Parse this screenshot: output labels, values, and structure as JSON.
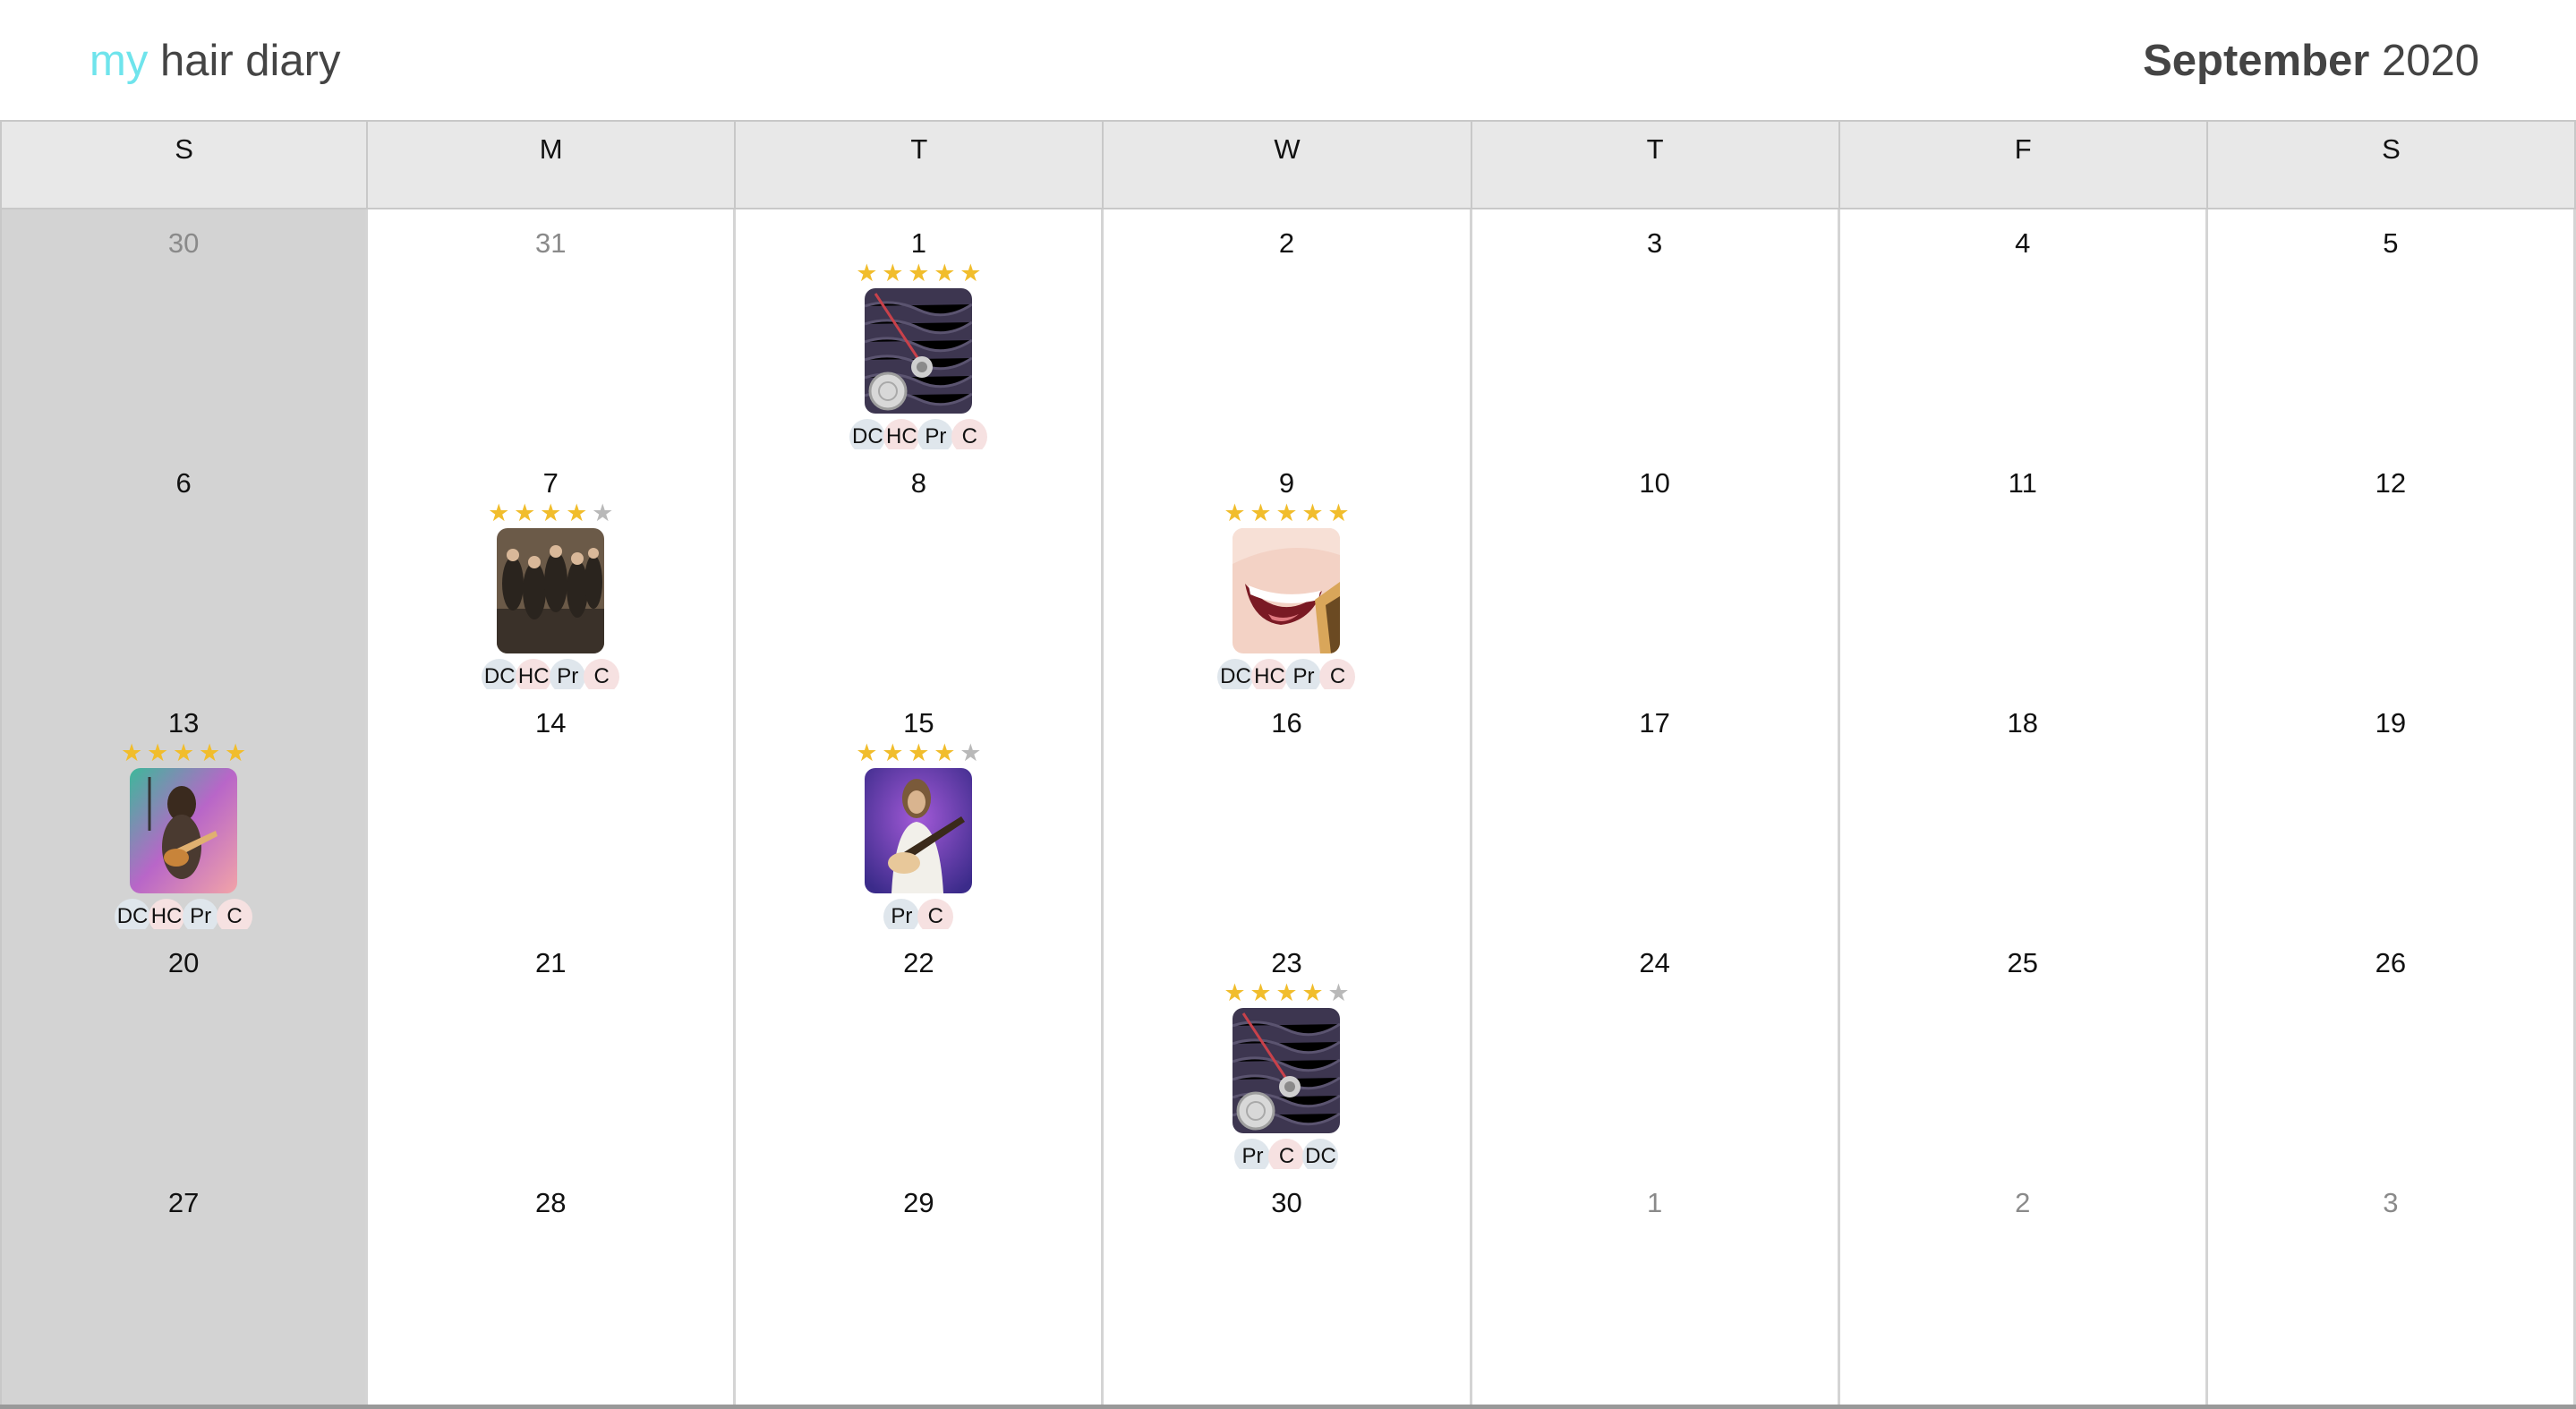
{
  "app": {
    "brand_prefix": "my",
    "brand_rest": " hair diary"
  },
  "header": {
    "month": "September",
    "year": " 2020"
  },
  "colors": {
    "brand_accent": "#6fe4ec",
    "star_on": "#f1bd2c",
    "star_off": "#b9b9b9",
    "sunday_bg": "#d3d3d3"
  },
  "weekdays": [
    "S",
    "M",
    "T",
    "W",
    "T",
    "F",
    "S"
  ],
  "weeks": [
    [
      {
        "day": "30",
        "other_month": true
      },
      {
        "day": "31",
        "other_month": true
      },
      {
        "day": "1",
        "entry": {
          "rating": 5,
          "image": "album-art-pendulum",
          "tags": [
            "DC",
            "HC",
            "Pr",
            "C"
          ]
        }
      },
      {
        "day": "2"
      },
      {
        "day": "3"
      },
      {
        "day": "4"
      },
      {
        "day": "5"
      }
    ],
    [
      {
        "day": "6"
      },
      {
        "day": "7",
        "entry": {
          "rating": 4,
          "image": "band-group-photo",
          "tags": [
            "DC",
            "HC",
            "Pr",
            "C"
          ]
        }
      },
      {
        "day": "8"
      },
      {
        "day": "9",
        "entry": {
          "rating": 5,
          "image": "smiling-mouth-photo",
          "tags": [
            "DC",
            "HC",
            "Pr",
            "C"
          ]
        }
      },
      {
        "day": "10"
      },
      {
        "day": "11"
      },
      {
        "day": "12"
      }
    ],
    [
      {
        "day": "13",
        "entry": {
          "rating": 5,
          "image": "guitarist-stage-photo",
          "tags": [
            "DC",
            "HC",
            "Pr",
            "C"
          ]
        }
      },
      {
        "day": "14"
      },
      {
        "day": "15",
        "entry": {
          "rating": 4,
          "image": "guitarist-purple-photo",
          "tags": [
            "Pr",
            "C"
          ]
        }
      },
      {
        "day": "16"
      },
      {
        "day": "17"
      },
      {
        "day": "18"
      },
      {
        "day": "19"
      }
    ],
    [
      {
        "day": "20"
      },
      {
        "day": "21"
      },
      {
        "day": "22"
      },
      {
        "day": "23",
        "entry": {
          "rating": 4,
          "image": "album-art-pendulum",
          "tags": [
            "Pr",
            "C",
            "DC"
          ]
        }
      },
      {
        "day": "24"
      },
      {
        "day": "25"
      },
      {
        "day": "26"
      }
    ],
    [
      {
        "day": "27"
      },
      {
        "day": "28"
      },
      {
        "day": "29"
      },
      {
        "day": "30"
      },
      {
        "day": "1",
        "other_month": true
      },
      {
        "day": "2",
        "other_month": true
      },
      {
        "day": "3",
        "other_month": true
      }
    ]
  ]
}
